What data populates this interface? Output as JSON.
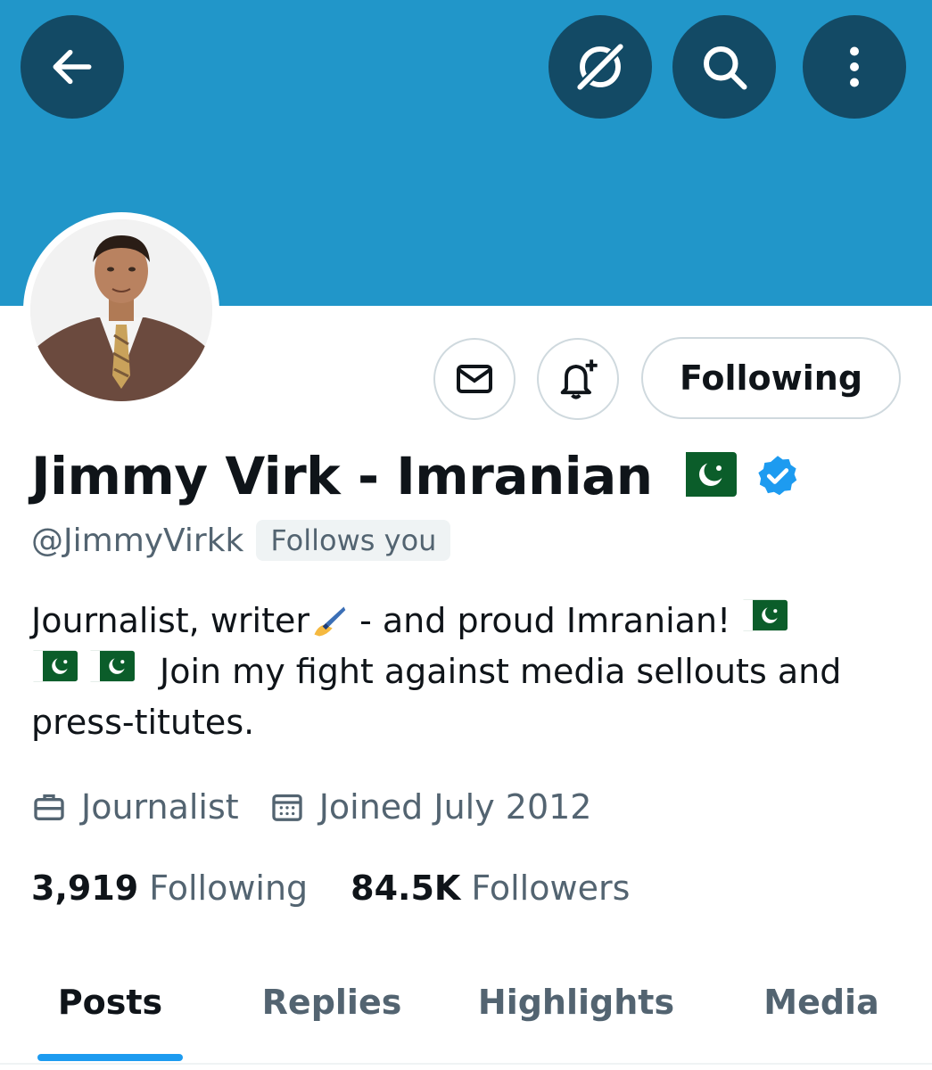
{
  "banner": {
    "color": "#2196c9"
  },
  "header_buttons": {
    "back": {
      "icon": "arrow-left-icon"
    },
    "grok": {
      "icon": "grok-icon"
    },
    "search": {
      "icon": "search-icon"
    },
    "more": {
      "icon": "more-vertical-icon"
    }
  },
  "profile": {
    "name": "Jimmy Virk - Imranian",
    "verified": true,
    "handle": "@JimmyVirkk",
    "follows_you_badge": "Follows you",
    "bio": {
      "line1": "Journalist, writer",
      "line1_after": " - and proud Imranian! ",
      "line2": "Join my fight against media sellouts and",
      "line3": "press-titutes."
    },
    "profession": "Journalist",
    "joined": "Joined July 2012",
    "following_count": "3,919",
    "following_label": "Following",
    "followers_count": "84.5K",
    "followers_label": "Followers"
  },
  "actions": {
    "message_icon": "mail-icon",
    "notify_icon": "bell-plus-icon",
    "following_button": "Following"
  },
  "tabs": [
    {
      "label": "Posts",
      "active": true
    },
    {
      "label": "Replies",
      "active": false
    },
    {
      "label": "Highlights",
      "active": false
    },
    {
      "label": "Media",
      "active": false
    }
  ],
  "colors": {
    "accent": "#1d9bf0",
    "header_button_bg": "#134a65",
    "secondary_text": "#536471"
  }
}
